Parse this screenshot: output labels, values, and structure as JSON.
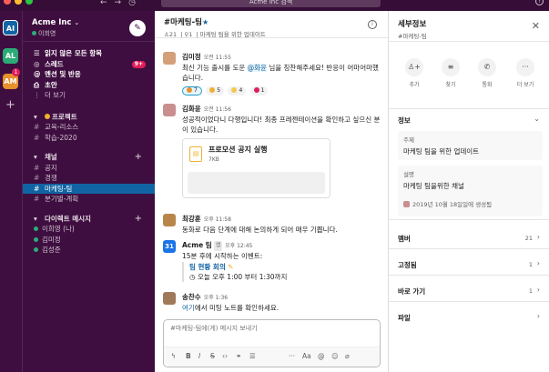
{
  "search": {
    "placeholder": "Acme Inc 검색"
  },
  "rail": {
    "workspaces": [
      {
        "label": "AI",
        "color": "#1264a3"
      },
      {
        "label": "AL",
        "color": "#2bac76"
      },
      {
        "label": "AM",
        "color": "#e8912d",
        "badge": "1"
      }
    ]
  },
  "sidebar": {
    "workspace_name": "Acme Inc",
    "user_status": "이희영",
    "top_items": [
      {
        "icon": "☰",
        "label": "읽지 않은 모든 항목"
      },
      {
        "icon": "◎",
        "label": "스레드",
        "badge": "9+"
      },
      {
        "icon": "@",
        "label": "멘션 및 반응"
      },
      {
        "icon": "⎙",
        "label": "초안"
      },
      {
        "icon": "⋮",
        "label": "더 보기"
      }
    ],
    "sections": {
      "projects": {
        "title": "프로젝트",
        "items": [
          "교육-리소스",
          "학습-2020"
        ]
      },
      "channels": {
        "title": "채널",
        "items": [
          "공지",
          "경쟁",
          "마케팅-팀",
          "분기별-계획"
        ]
      },
      "dms": {
        "title": "다이렉트 메시지",
        "items": [
          "이희영 (나)",
          "김미정",
          "김성준"
        ]
      }
    }
  },
  "channel": {
    "title": "#마케팅-팀",
    "members": "21",
    "pinned": "1",
    "topic": "마케팅 팀을 위한 업데이트"
  },
  "messages": [
    {
      "author": "김미정",
      "time": "오전 11:55",
      "text_before": "최신 기능 출시를 도운 ",
      "mention": "@화윤",
      "text_after": " 님을 칭찬해주세요! 반응이 어마어마했습니다.",
      "reactions": [
        "7",
        "5",
        "4",
        "1"
      ]
    },
    {
      "author": "김화윤",
      "time": "오전 11:56",
      "text": "성공적이었다니 다행입니다! 최종 프레젠테이션을 확인하고 싶으신 분이 있습니다.",
      "file": {
        "title": "프로모션 공지 실행",
        "size": "7KB"
      }
    },
    {
      "author": "최강훈",
      "time": "오후 11:58",
      "text": "동화로 다음 단계에 대해 논의하게 되어 매우 기쁩니다."
    },
    {
      "author": "Acme 팀",
      "tag": "앱",
      "time": "오후 12:45",
      "text": "15분 후에 시작하는 이벤트:",
      "event_title": "팀 현황 회의",
      "event_time": "오늘 오후 1:00 부터 1:30까지"
    },
    {
      "author": "송찬수",
      "time": "오후 1:36",
      "link": "여기",
      "text": "에서 미팅 노트를 확인하세요."
    }
  ],
  "composer": {
    "placeholder": "#마케팅-팀에(게) 메시지 보내기"
  },
  "details": {
    "title": "세부정보",
    "subtitle": "#마케팅-팀",
    "actions": [
      "추가",
      "찾기",
      "통화",
      "더 보기"
    ],
    "info_heading": "정보",
    "topic_label": "주제",
    "topic_value": "마케팅 팀을 위한 업데이트",
    "desc_label": "설명",
    "desc_value": "마케팅 팀을위한 채널",
    "created": "2019년 10월 18일일에 생성됨",
    "rows": [
      {
        "label": "멤버",
        "count": "21"
      },
      {
        "label": "고정됨",
        "count": "1"
      },
      {
        "label": "바로 가기",
        "count": "1"
      },
      {
        "label": "파일",
        "count": ""
      }
    ]
  }
}
